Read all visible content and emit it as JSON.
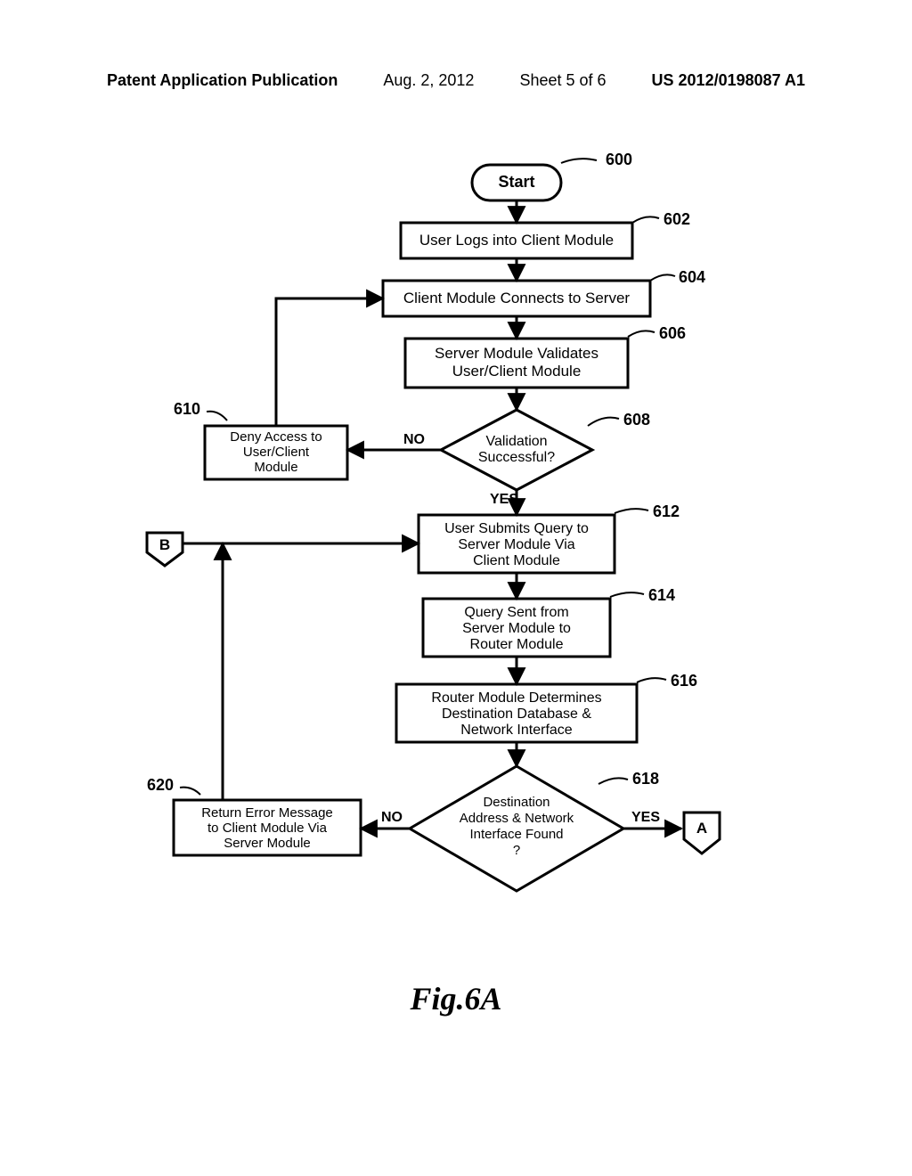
{
  "header": {
    "publication": "Patent Application Publication",
    "date": "Aug. 2, 2012",
    "sheet": "Sheet 5 of 6",
    "pubno": "US 2012/0198087 A1"
  },
  "chart_data": {
    "type": "flowchart",
    "title": "Fig.6A",
    "nodes": [
      {
        "id": "600",
        "ref": "600",
        "shape": "terminator",
        "text": "Start"
      },
      {
        "id": "602",
        "ref": "602",
        "shape": "process",
        "text": "User Logs into Client Module"
      },
      {
        "id": "604",
        "ref": "604",
        "shape": "process",
        "text": "Client Module Connects to Server"
      },
      {
        "id": "606",
        "ref": "606",
        "shape": "process",
        "text": "Server Module Validates User/Client Module"
      },
      {
        "id": "608",
        "ref": "608",
        "shape": "decision",
        "text": "Validation Successful?"
      },
      {
        "id": "610",
        "ref": "610",
        "shape": "process",
        "text": "Deny Access to User/Client Module"
      },
      {
        "id": "612",
        "ref": "612",
        "shape": "process",
        "text": "User Submits Query to Server Module Via Client Module"
      },
      {
        "id": "614",
        "ref": "614",
        "shape": "process",
        "text": "Query Sent from Server Module to Router Module"
      },
      {
        "id": "616",
        "ref": "616",
        "shape": "process",
        "text": "Router Module Determines Destination Database & Network Interface"
      },
      {
        "id": "618",
        "ref": "618",
        "shape": "decision",
        "text": "Destination Address & Network Interface Found ?"
      },
      {
        "id": "620",
        "ref": "620",
        "shape": "process",
        "text": "Return Error Message to Client Module Via Server Module"
      },
      {
        "id": "A",
        "shape": "offpage",
        "text": "A"
      },
      {
        "id": "B",
        "shape": "offpage",
        "text": "B"
      }
    ],
    "edges": [
      {
        "from": "600",
        "to": "602"
      },
      {
        "from": "602",
        "to": "604"
      },
      {
        "from": "604",
        "to": "606"
      },
      {
        "from": "606",
        "to": "608"
      },
      {
        "from": "608",
        "to": "610",
        "label": "NO"
      },
      {
        "from": "608",
        "to": "612",
        "label": "YES"
      },
      {
        "from": "610",
        "to": "604"
      },
      {
        "from": "612",
        "to": "614"
      },
      {
        "from": "614",
        "to": "616"
      },
      {
        "from": "616",
        "to": "618"
      },
      {
        "from": "618",
        "to": "620",
        "label": "NO"
      },
      {
        "from": "618",
        "to": "A",
        "label": "YES"
      },
      {
        "from": "B",
        "to": "612"
      },
      {
        "from": "620",
        "to": "612"
      }
    ],
    "labels": {
      "no": "NO",
      "yes": "YES"
    }
  },
  "connectors": {
    "A": "A",
    "B": "B"
  },
  "figure_label": "Fig.6A"
}
